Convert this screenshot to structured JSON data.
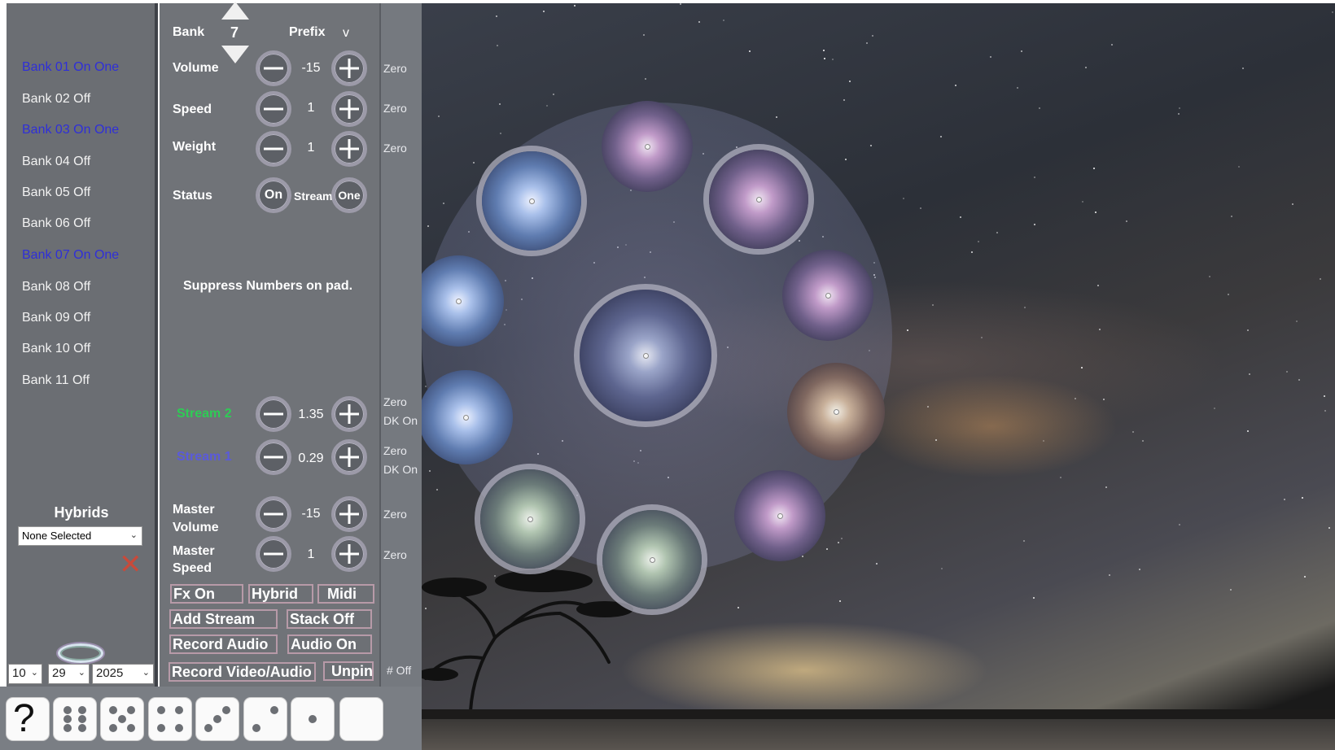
{
  "banks": [
    {
      "label": "Bank 01 On One",
      "on": true
    },
    {
      "label": "Bank 02 Off",
      "on": false
    },
    {
      "label": "Bank 03 On One",
      "on": true
    },
    {
      "label": "Bank 04 Off",
      "on": false
    },
    {
      "label": "Bank 05 Off",
      "on": false
    },
    {
      "label": "Bank 06 Off",
      "on": false
    },
    {
      "label": "Bank 07 On One",
      "on": true
    },
    {
      "label": "Bank 08 Off",
      "on": false
    },
    {
      "label": "Bank 09 Off",
      "on": false
    },
    {
      "label": "Bank 10 Off",
      "on": false
    },
    {
      "label": "Bank 11 Off",
      "on": false
    }
  ],
  "hybrids": {
    "title": "Hybrids",
    "selected": "None Selected"
  },
  "date": {
    "month": "10",
    "day": "29",
    "year": "2025"
  },
  "header": {
    "bank_label": "Bank",
    "bank_number": "7",
    "prefix_label": "Prefix",
    "prefix_value": "v"
  },
  "controls": {
    "volume": {
      "label": "Volume",
      "value": "-15",
      "zero": "Zero"
    },
    "speed": {
      "label": "Speed",
      "value": "1",
      "zero": "Zero"
    },
    "weight": {
      "label": "Weight",
      "value": "1",
      "zero": "Zero"
    },
    "status": {
      "label": "Status",
      "on_label": "On",
      "stream_label": "Stream",
      "one_label": "One"
    }
  },
  "suppress_text": "Suppress Numbers on pad.",
  "streams": [
    {
      "label": "Stream 2",
      "color": "#2ecc55",
      "value": "1.35",
      "zero": "Zero",
      "dk": "DK On"
    },
    {
      "label": "Stream 1",
      "color": "#5a5adc",
      "value": "0.29",
      "zero": "Zero",
      "dk": "DK On"
    }
  ],
  "master": {
    "volume": {
      "label_line1": "Master",
      "label_line2": "Volume",
      "value": "-15",
      "zero": "Zero"
    },
    "speed": {
      "label_line1": "Master",
      "label_line2": "Speed",
      "value": "1",
      "zero": "Zero"
    }
  },
  "buttons": {
    "fx": "Fx On",
    "hybrid": "Hybrid",
    "midi": "Midi",
    "add_stream": "Add Stream",
    "stack": "Stack Off",
    "record_audio": "Record Audio",
    "audio": "Audio On",
    "record_video": "Record Video/Audio",
    "unpin": "Unpin",
    "hash_off": "# Off"
  },
  "dice": [
    "help",
    "6",
    "5",
    "4",
    "3",
    "2",
    "1",
    "0"
  ],
  "colors": {
    "bank_on": "#2f2fd8",
    "bank_off": "#f2f2f2",
    "close_x": "#c84a3a"
  }
}
